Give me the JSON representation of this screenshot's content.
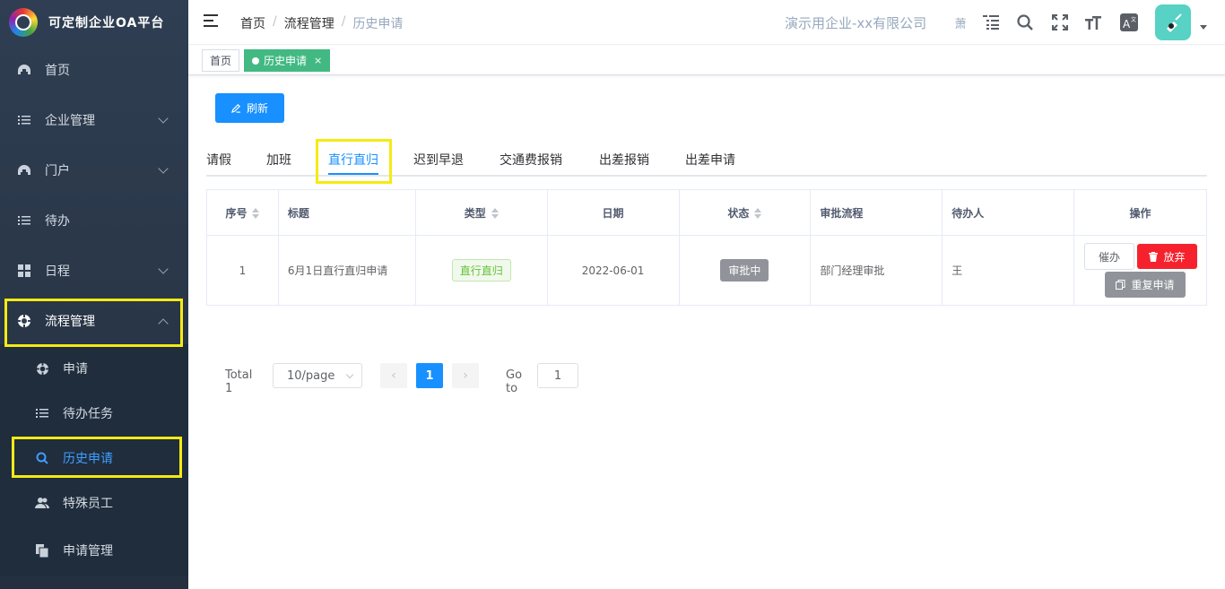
{
  "app": {
    "title": "可定制企业OA平台"
  },
  "sidebar": {
    "items": [
      {
        "label": "首页",
        "icon": "dashboard-icon"
      },
      {
        "label": "企业管理",
        "icon": "list-icon"
      },
      {
        "label": "门户",
        "icon": "dashboard-icon"
      },
      {
        "label": "待办",
        "icon": "list-icon"
      },
      {
        "label": "日程",
        "icon": "grid-icon"
      },
      {
        "label": "流程管理",
        "icon": "process-icon"
      }
    ],
    "sub_items": [
      {
        "label": "申请",
        "icon": "process-icon"
      },
      {
        "label": "待办任务",
        "icon": "list-icon"
      },
      {
        "label": "历史申请",
        "icon": "search-icon"
      },
      {
        "label": "特殊员工",
        "icon": "peoples-icon"
      },
      {
        "label": "申请管理",
        "icon": "documents-icon"
      }
    ]
  },
  "header": {
    "breadcrumb": [
      "首页",
      "流程管理",
      "历史申请"
    ],
    "company": "演示用企业-xx有限公司",
    "short_name": "萧"
  },
  "tags_view": {
    "tags": [
      {
        "label": "首页"
      },
      {
        "label": "历史申请"
      }
    ],
    "close": "×"
  },
  "toolbar": {
    "refresh_label": "刷新"
  },
  "tabs": [
    "请假",
    "加班",
    "直行直归",
    "迟到早退",
    "交通费报销",
    "出差报销",
    "出差申请"
  ],
  "table": {
    "headers": [
      "序号",
      "标题",
      "类型",
      "日期",
      "状态",
      "审批流程",
      "待办人",
      "操作"
    ],
    "rows": [
      {
        "index": "1",
        "title": "6月1日直行直归申请",
        "type": "直行直归",
        "date": "2022-06-01",
        "status": "审批中",
        "flow": "部门经理审批",
        "assignee": "王"
      }
    ],
    "actions": {
      "urge": "催办",
      "abandon": "放弃",
      "reapply": "重复申请"
    }
  },
  "pagination": {
    "total": "Total 1",
    "page_size": "10/page",
    "current_page": "1",
    "goto_label": "Go to",
    "goto_value": "1",
    "prev": "‹",
    "next": "›"
  },
  "colors": {
    "primary": "#1890ff",
    "sidebar_bg": "#2f3e52",
    "highlight": "#f5ea14",
    "tag_active": "#42b983",
    "danger": "#f5222d"
  }
}
